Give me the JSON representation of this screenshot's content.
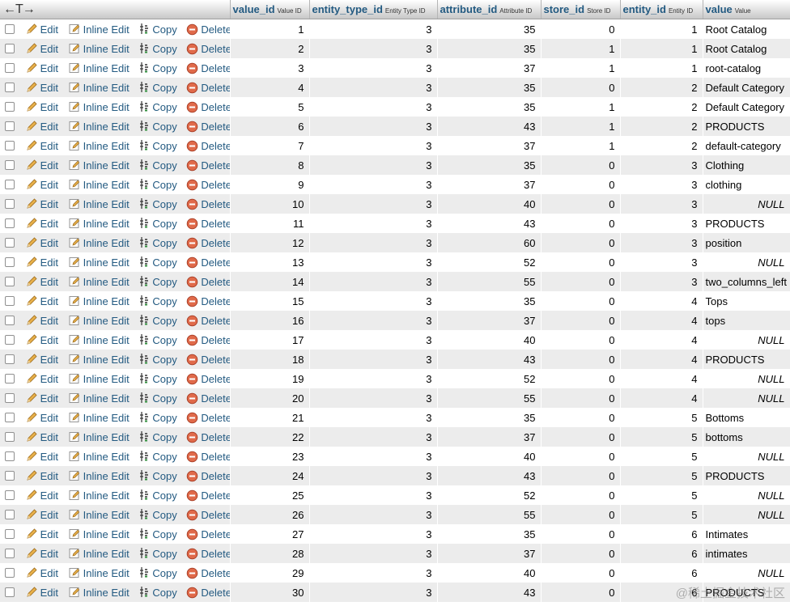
{
  "header": {
    "sort_arrows": "←T→",
    "columns": [
      {
        "name": "value_id",
        "comment": "Value ID"
      },
      {
        "name": "entity_type_id",
        "comment": "Entity Type ID"
      },
      {
        "name": "attribute_id",
        "comment": "Attribute ID"
      },
      {
        "name": "store_id",
        "comment": "Store ID"
      },
      {
        "name": "entity_id",
        "comment": "Entity ID"
      },
      {
        "name": "value",
        "comment": "Value"
      }
    ]
  },
  "actions": {
    "edit": "Edit",
    "inline_edit": "Inline Edit",
    "copy": "Copy",
    "delete": "Delete"
  },
  "rows": [
    [
      "1",
      "3",
      "35",
      "0",
      "1",
      "Root Catalog"
    ],
    [
      "2",
      "3",
      "35",
      "1",
      "1",
      "Root Catalog"
    ],
    [
      "3",
      "3",
      "37",
      "1",
      "1",
      "root-catalog"
    ],
    [
      "4",
      "3",
      "35",
      "0",
      "2",
      "Default Category"
    ],
    [
      "5",
      "3",
      "35",
      "1",
      "2",
      "Default Category"
    ],
    [
      "6",
      "3",
      "43",
      "1",
      "2",
      "PRODUCTS"
    ],
    [
      "7",
      "3",
      "37",
      "1",
      "2",
      "default-category"
    ],
    [
      "8",
      "3",
      "35",
      "0",
      "3",
      "Clothing"
    ],
    [
      "9",
      "3",
      "37",
      "0",
      "3",
      "clothing"
    ],
    [
      "10",
      "3",
      "40",
      "0",
      "3",
      "NULL"
    ],
    [
      "11",
      "3",
      "43",
      "0",
      "3",
      "PRODUCTS"
    ],
    [
      "12",
      "3",
      "60",
      "0",
      "3",
      "position"
    ],
    [
      "13",
      "3",
      "52",
      "0",
      "3",
      "NULL"
    ],
    [
      "14",
      "3",
      "55",
      "0",
      "3",
      "two_columns_left"
    ],
    [
      "15",
      "3",
      "35",
      "0",
      "4",
      "Tops"
    ],
    [
      "16",
      "3",
      "37",
      "0",
      "4",
      "tops"
    ],
    [
      "17",
      "3",
      "40",
      "0",
      "4",
      "NULL"
    ],
    [
      "18",
      "3",
      "43",
      "0",
      "4",
      "PRODUCTS"
    ],
    [
      "19",
      "3",
      "52",
      "0",
      "4",
      "NULL"
    ],
    [
      "20",
      "3",
      "55",
      "0",
      "4",
      "NULL"
    ],
    [
      "21",
      "3",
      "35",
      "0",
      "5",
      "Bottoms"
    ],
    [
      "22",
      "3",
      "37",
      "0",
      "5",
      "bottoms"
    ],
    [
      "23",
      "3",
      "40",
      "0",
      "5",
      "NULL"
    ],
    [
      "24",
      "3",
      "43",
      "0",
      "5",
      "PRODUCTS"
    ],
    [
      "25",
      "3",
      "52",
      "0",
      "5",
      "NULL"
    ],
    [
      "26",
      "3",
      "55",
      "0",
      "5",
      "NULL"
    ],
    [
      "27",
      "3",
      "35",
      "0",
      "6",
      "Intimates"
    ],
    [
      "28",
      "3",
      "37",
      "0",
      "6",
      "intimates"
    ],
    [
      "29",
      "3",
      "40",
      "0",
      "6",
      "NULL"
    ],
    [
      "30",
      "3",
      "43",
      "0",
      "6",
      "PRODUCTS"
    ]
  ],
  "watermark": "@稀土掘金技术社区",
  "colors": {
    "link": "#235a81",
    "row_alt": "#ececec",
    "header_bg_bottom": "#c8c8c8"
  }
}
